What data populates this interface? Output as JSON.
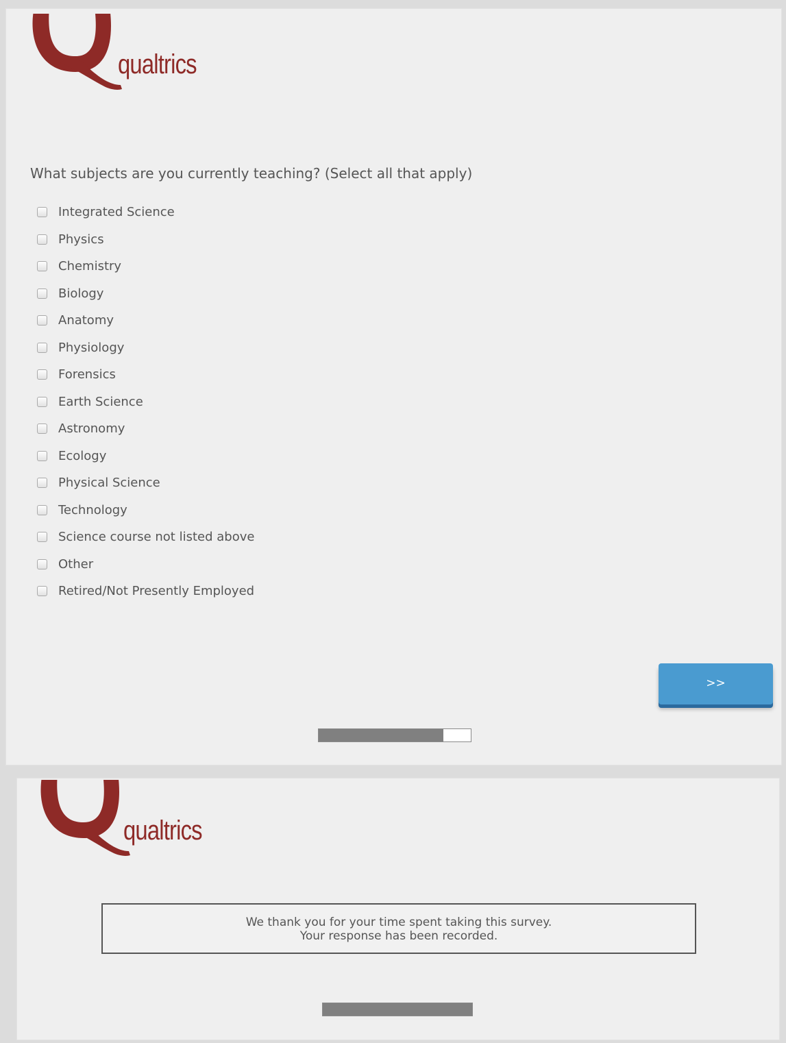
{
  "brand": {
    "name": "qualtrics",
    "color": "#8e2a27",
    "logo_icon": "qualtrics-q-logo"
  },
  "survey_page": {
    "question": "What subjects are you currently teaching? (Select all that apply)",
    "options": [
      "Integrated Science",
      "Physics",
      "Chemistry",
      "Biology",
      "Anatomy",
      "Physiology",
      "Forensics",
      "Earth Science",
      "Astronomy",
      "Ecology",
      "Physical Science",
      "Technology",
      "Science course not listed above",
      "Other",
      "Retired/Not Presently Employed"
    ],
    "next_button_label": ">>",
    "next_button_color": "#4a9bd0",
    "progress_fraction": 0.82
  },
  "end_page": {
    "thanks_line1": "We thank you for your time spent taking this survey.",
    "thanks_line2": "Your response has been recorded.",
    "progress_fraction": 1.0
  }
}
